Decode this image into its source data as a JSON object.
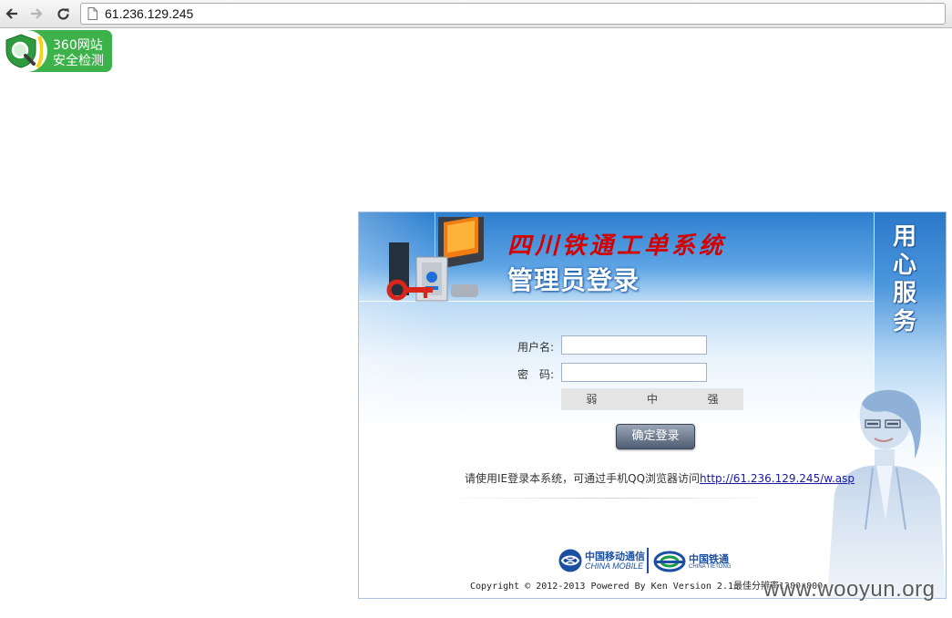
{
  "browser": {
    "url": "61.236.129.245",
    "icons": [
      "back-arrow-icon",
      "forward-arrow-icon",
      "reload-icon",
      "page-icon"
    ]
  },
  "badge360": {
    "line1": "360网站",
    "line2": "安全检测",
    "icon": "shield-magnifier-icon",
    "color": "#3db24a"
  },
  "login": {
    "system_title": "四川铁通工单系统",
    "admin_title": "管理员登录",
    "slogan": [
      "用",
      "心",
      "服",
      "务"
    ],
    "username_label": "用户名:",
    "password_label": "密　码:",
    "username_value": "",
    "password_value": "",
    "strength": [
      "弱",
      "中",
      "强"
    ],
    "submit_label": "确定登录",
    "hint_text": "请使用IE登录本系统，可通过手机QQ浏览器访问",
    "hint_link": "http://61.236.129.245/w.asp",
    "logos": {
      "cm_cn": "中国移动通信",
      "cm_en": "CHINA MOBILE",
      "ct_cn": "中国铁通",
      "ct_en": "CHINA TIETONG"
    },
    "copyright": "Copyright © 2012-2013 Powered By Ken Version 2.1最佳分辨率1280*800"
  },
  "watermark": "www.wooyun.org",
  "colors": {
    "panel_blue": "#2e7fd0",
    "title_red": "#d40000",
    "link_blue": "#1a1aa6"
  }
}
